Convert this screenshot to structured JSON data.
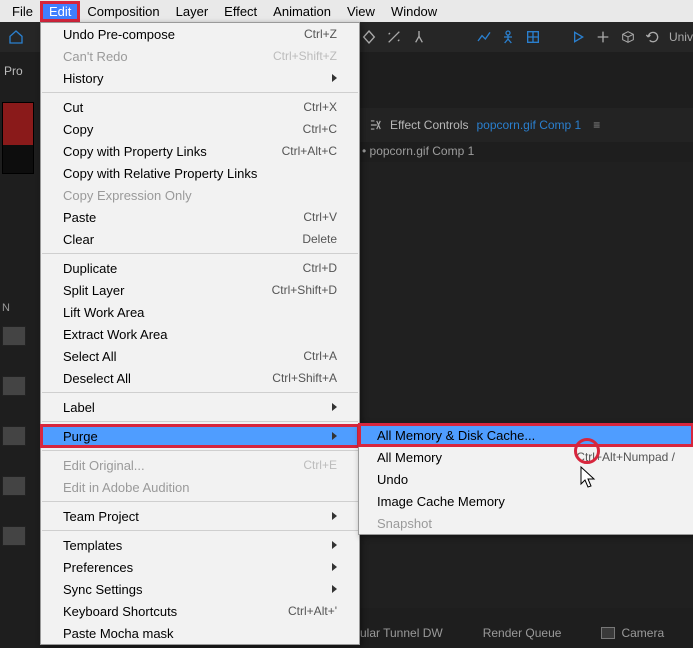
{
  "menubar": {
    "file": "File",
    "edit": "Edit",
    "composition": "Composition",
    "layer": "Layer",
    "effect": "Effect",
    "animation": "Animation",
    "view": "View",
    "window": "Window"
  },
  "toolbar": {
    "univ_label": "Univ"
  },
  "project_panel": {
    "label_prefix": "Pro"
  },
  "effect_controls": {
    "title": "Effect Controls",
    "link": "popcorn.gif Comp 1",
    "breadcrumb": "• popcorn.gif Comp 1"
  },
  "edit_menu": [
    {
      "label": "Undo Pre-compose",
      "shortcut": "Ctrl+Z"
    },
    {
      "label": "Can't Redo",
      "shortcut": "Ctrl+Shift+Z",
      "disabled": true
    },
    {
      "label": "History",
      "submenu": true
    },
    {
      "type": "sep"
    },
    {
      "label": "Cut",
      "shortcut": "Ctrl+X"
    },
    {
      "label": "Copy",
      "shortcut": "Ctrl+C"
    },
    {
      "label": "Copy with Property Links",
      "shortcut": "Ctrl+Alt+C"
    },
    {
      "label": "Copy with Relative Property Links"
    },
    {
      "label": "Copy Expression Only",
      "disabled": true
    },
    {
      "label": "Paste",
      "shortcut": "Ctrl+V"
    },
    {
      "label": "Clear",
      "shortcut": "Delete"
    },
    {
      "type": "sep"
    },
    {
      "label": "Duplicate",
      "shortcut": "Ctrl+D"
    },
    {
      "label": "Split Layer",
      "shortcut": "Ctrl+Shift+D"
    },
    {
      "label": "Lift Work Area"
    },
    {
      "label": "Extract Work Area"
    },
    {
      "label": "Select All",
      "shortcut": "Ctrl+A"
    },
    {
      "label": "Deselect All",
      "shortcut": "Ctrl+Shift+A"
    },
    {
      "type": "sep"
    },
    {
      "label": "Label",
      "submenu": true
    },
    {
      "type": "sep"
    },
    {
      "label": "Purge",
      "submenu": true,
      "selected": true,
      "redbox": true
    },
    {
      "type": "sep"
    },
    {
      "label": "Edit Original...",
      "shortcut": "Ctrl+E",
      "disabled": true
    },
    {
      "label": "Edit in Adobe Audition",
      "disabled": true
    },
    {
      "type": "sep"
    },
    {
      "label": "Team Project",
      "submenu": true
    },
    {
      "type": "sep"
    },
    {
      "label": "Templates",
      "submenu": true
    },
    {
      "label": "Preferences",
      "submenu": true
    },
    {
      "label": "Sync Settings",
      "submenu": true
    },
    {
      "label": "Keyboard Shortcuts",
      "shortcut": "Ctrl+Alt+'"
    },
    {
      "label": "Paste Mocha mask"
    }
  ],
  "purge_submenu": [
    {
      "label": "All Memory & Disk Cache...",
      "selected": true,
      "redbox": true
    },
    {
      "label": "All Memory",
      "shortcut": "Ctrl+Alt+Numpad /"
    },
    {
      "label": "Undo"
    },
    {
      "label": "Image Cache Memory"
    },
    {
      "label": "Snapshot",
      "disabled": true
    }
  ],
  "timeline_tabs": {
    "tab1": "ular Tunnel DW",
    "tab2": "Render Queue",
    "tab3": "Camera"
  }
}
